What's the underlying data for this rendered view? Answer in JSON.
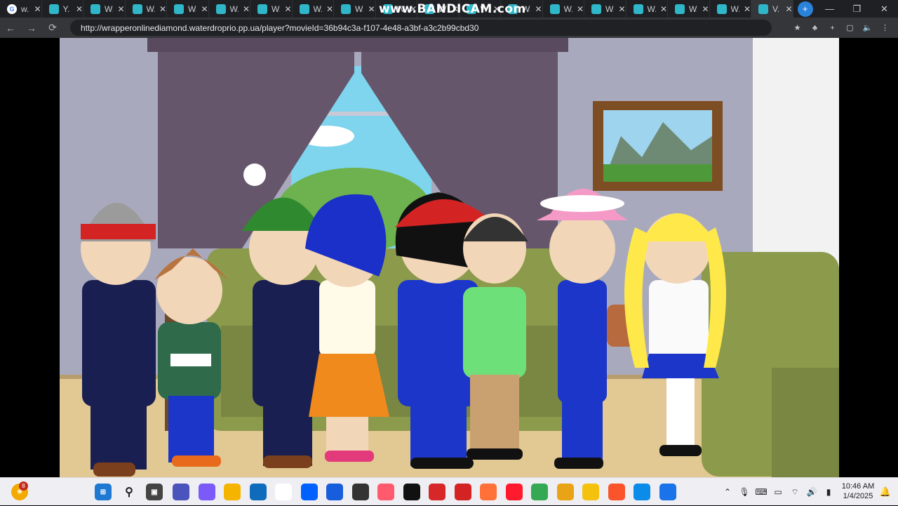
{
  "browser": {
    "tabs": [
      {
        "label": "w.",
        "icon": "google-icon"
      },
      {
        "label": "Y.",
        "icon": "wrapper-icon"
      },
      {
        "label": "W.",
        "icon": "wrapper-icon"
      },
      {
        "label": "W.",
        "icon": "wrapper-icon"
      },
      {
        "label": "W.",
        "icon": "wrapper-icon"
      },
      {
        "label": "W.",
        "icon": "wrapper-icon"
      },
      {
        "label": "W.",
        "icon": "wrapper-icon"
      },
      {
        "label": "W.",
        "icon": "wrapper-icon"
      },
      {
        "label": "W.",
        "icon": "wrapper-icon"
      },
      {
        "label": "W.",
        "icon": "wrapper-icon"
      },
      {
        "label": "W.",
        "icon": "wrapper-icon"
      },
      {
        "label": "W.",
        "icon": "wrapper-icon"
      },
      {
        "label": "W.",
        "icon": "wrapper-icon"
      },
      {
        "label": "W.",
        "icon": "wrapper-icon"
      },
      {
        "label": "W.",
        "icon": "wrapper-icon"
      },
      {
        "label": "W.",
        "icon": "wrapper-icon"
      },
      {
        "label": "W.",
        "icon": "wrapper-icon"
      },
      {
        "label": "W.",
        "icon": "wrapper-icon"
      },
      {
        "label": "V.",
        "icon": "wrapper-icon",
        "active": true
      }
    ],
    "tab_close": "✕",
    "new_tab": "+",
    "watermark": "www.BANDICAM.com",
    "url": "http://wrapperonlinediamond.waterdroprio.pp.ua/player?movieId=36b94c3a-f107-4e48-a3bf-a3c2b99cbd30",
    "window_controls": {
      "minimize": "—",
      "restore": "❐",
      "close": "✕"
    }
  },
  "taskbar": {
    "notification_count": "8",
    "time": "10:46 AM",
    "date": "1/4/2025",
    "pinned": [
      "teams",
      "copilot",
      "file-explorer",
      "store",
      "amazon",
      "dropbox",
      "bitwarden",
      "ia",
      "camera",
      "screen-recorder",
      "bandicam",
      "goanimate",
      "firefox",
      "opera",
      "chrome",
      "edge-canary",
      "chrome-beta",
      "brave",
      "edge",
      "edge-dev"
    ]
  },
  "colors": {
    "accent": "#2fb7c9",
    "tabbar": "#1f2023",
    "toolbar": "#35363a",
    "taskbar": "#efeff3"
  }
}
